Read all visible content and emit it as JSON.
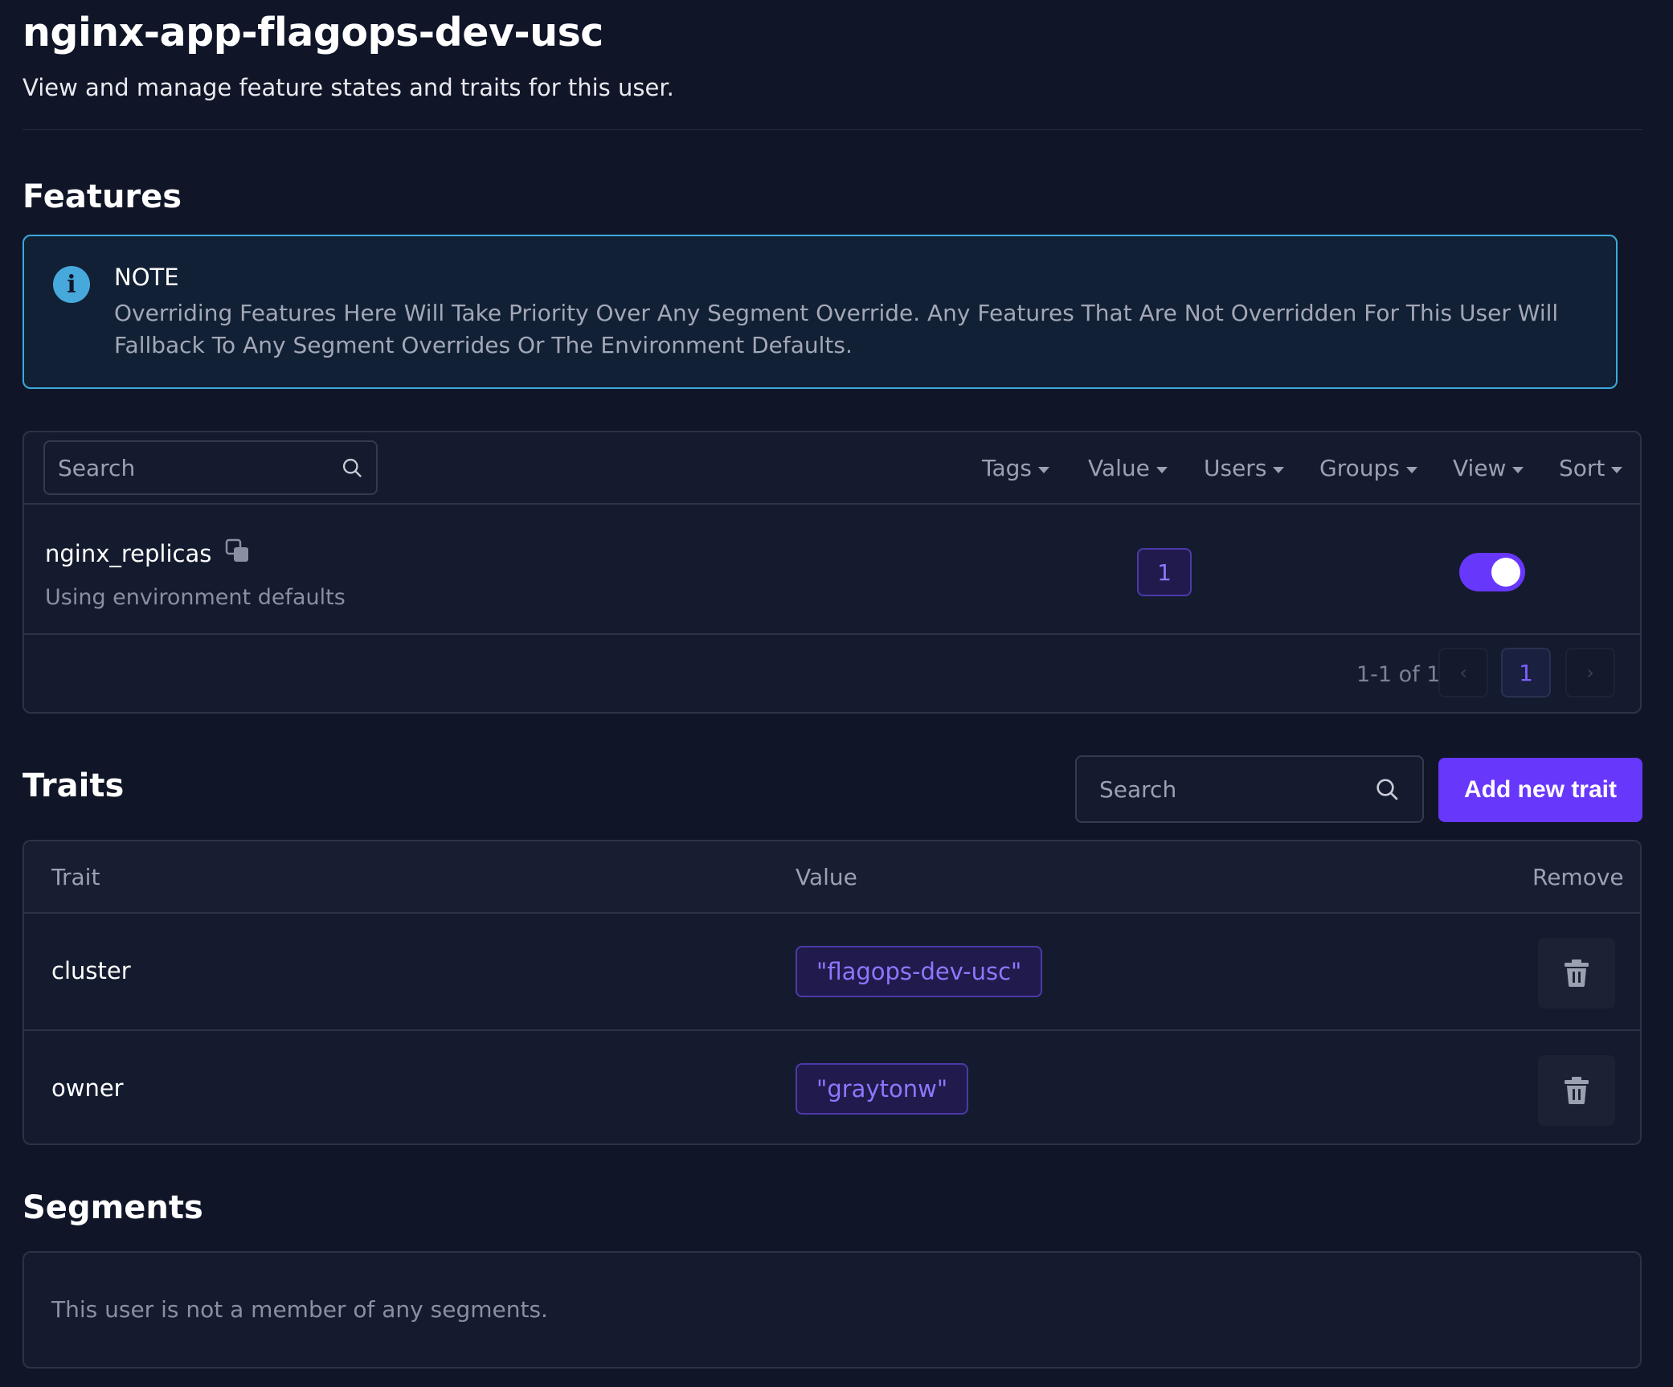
{
  "header": {
    "title": "nginx-app-flagops-dev-usc",
    "subtitle": "View and manage feature states and traits for this user."
  },
  "features": {
    "section_title": "Features",
    "note": {
      "icon": "info-icon",
      "title": "NOTE",
      "text": "Overriding Features Here Will Take Priority Over Any Segment Override. Any Features That Are Not Overridden For This User Will Fallback To Any Segment Overrides Or The Environment Defaults."
    },
    "search_placeholder": "Search",
    "filters": [
      "Tags",
      "Value",
      "Users",
      "Groups",
      "View",
      "Sort"
    ],
    "rows": [
      {
        "name": "nginx_replicas",
        "description": "Using environment defaults",
        "value": "1",
        "enabled": true
      }
    ],
    "pagination": {
      "info": "1-1 of 1",
      "current_page": "1",
      "prev": "‹",
      "next": "›"
    }
  },
  "traits": {
    "section_title": "Traits",
    "search_placeholder": "Search",
    "add_button": "Add new trait",
    "columns": [
      "Trait",
      "Value",
      "Remove"
    ],
    "rows": [
      {
        "trait": "cluster",
        "value": "\"flagops-dev-usc\""
      },
      {
        "trait": "owner",
        "value": "\"graytonw\""
      }
    ]
  },
  "segments": {
    "section_title": "Segments",
    "empty_text": "This user is not a member of any segments."
  },
  "colors": {
    "background": "#101628",
    "accent": "#6837fc",
    "info": "#3ca9dc"
  }
}
